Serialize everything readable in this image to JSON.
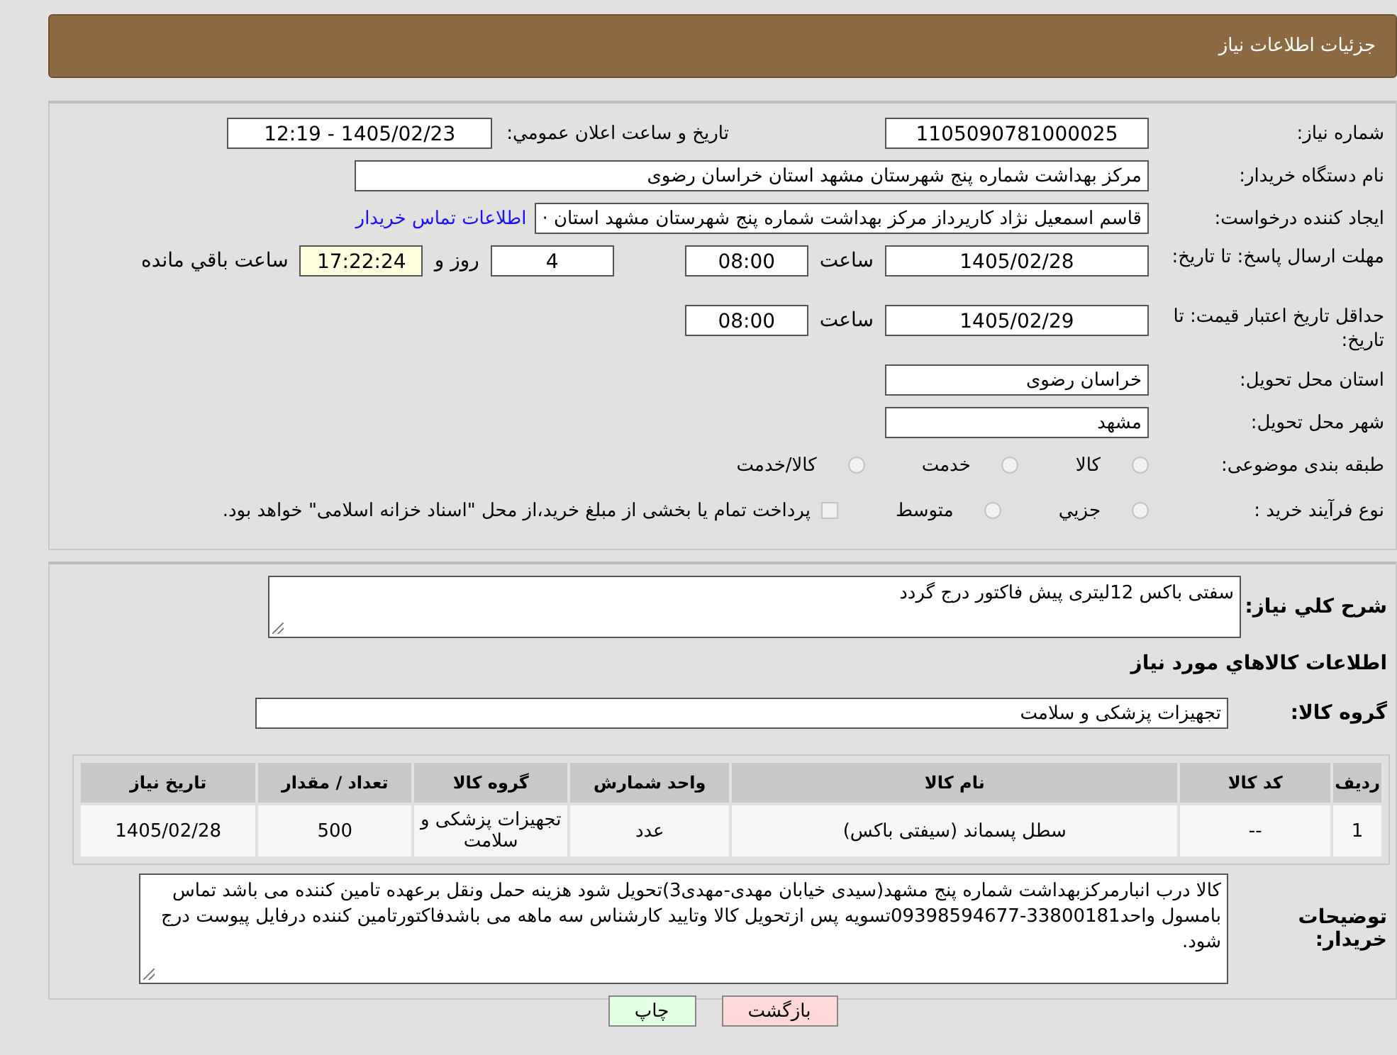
{
  "header": {
    "title": "جزئیات اطلاعات نیاز"
  },
  "need_number": {
    "label": "شماره نیاز:",
    "value": "1105090781000025"
  },
  "announce": {
    "label": "تاریخ و ساعت اعلان عمومي:",
    "value": "1405/02/23 - 12:19"
  },
  "buyer_org": {
    "label": "نام دستگاه خریدار:",
    "value": "مرکز بهداشت شماره پنج شهرستان مشهد استان خراسان رضوی"
  },
  "requester": {
    "label": "ایجاد کننده درخواست:",
    "value": "قاسم  اسمعیل نژاد کاریرداز مرکز بهداشت شماره پنج شهرستان مشهد استان ·",
    "link": "اطلاعات تماس خریدار"
  },
  "reply_deadline": {
    "label": "مهلت ارسال پاسخ: تا تاریخ:",
    "date": "1405/02/28",
    "time_label": "ساعت",
    "time": "08:00",
    "days": "4",
    "days_label": "روز و",
    "remaining": "17:22:24",
    "remaining_label": "ساعت باقي مانده"
  },
  "price_validity": {
    "label": "حداقل تاریخ اعتبار قیمت: تا تاریخ:",
    "date": "1405/02/29",
    "time_label": "ساعت",
    "time": "08:00"
  },
  "province": {
    "label": "استان محل تحویل:",
    "value": "خراسان رضوی"
  },
  "city": {
    "label": "شهر محل تحویل:",
    "value": "مشهد"
  },
  "category": {
    "label": "طبقه بندی موضوعی:",
    "options": [
      {
        "label": "کالا",
        "selected": false
      },
      {
        "label": "خدمت",
        "selected": false
      },
      {
        "label": "کالا/خدمت",
        "selected": false
      }
    ]
  },
  "purchase_type": {
    "label": "نوع فرآیند خرید :",
    "options": [
      {
        "label": "جزيي",
        "selected": false
      },
      {
        "label": "متوسط",
        "selected": false
      }
    ],
    "payment": {
      "label": "پرداخت تمام یا بخشی از مبلغ خرید،از محل \"اسناد خزانه اسلامی\" خواهد بود.",
      "checked": false
    }
  },
  "summary": {
    "label": "شرح کلي نیاز:",
    "value": "سفتی باکس 12لیتری پیش فاکتور درج گردد"
  },
  "goods_heading": "اطلاعات کالاهاي مورد نیاز",
  "goods_group": {
    "label": "گروه کالا:",
    "value": "تجهیزات پزشکی و سلامت"
  },
  "table": {
    "columns": [
      "ردیف",
      "کد کالا",
      "نام کالا",
      "واحد شمارش",
      "گروه کالا",
      "تعداد / مقدار",
      "تاریخ نیاز"
    ],
    "rows": [
      [
        "1",
        "--",
        "سطل پسماند (سیفتی باکس)",
        "عدد",
        "تجهیزات پزشکی و سلامت",
        "500",
        "1405/02/28"
      ]
    ]
  },
  "buyer_notes": {
    "label": "توضیحات خریدار:",
    "value": "کالا درب انبارمرکزبهداشت شماره پنج مشهد(سیدی خیابان مهدی-مهدی3)تحویل شود هزینه حمل ونقل برعهده تامین کننده می باشد  تماس بامسول واحد33800181-09398594677تسویه پس ازتحویل کالا وتایید کارشناس سه ماهه می باشدفاکتورتامین کننده درفایل پیوست درج شود."
  },
  "buttons": [
    {
      "label": "بازگشت",
      "kind": "back"
    },
    {
      "label": "چاپ",
      "kind": "print"
    }
  ]
}
